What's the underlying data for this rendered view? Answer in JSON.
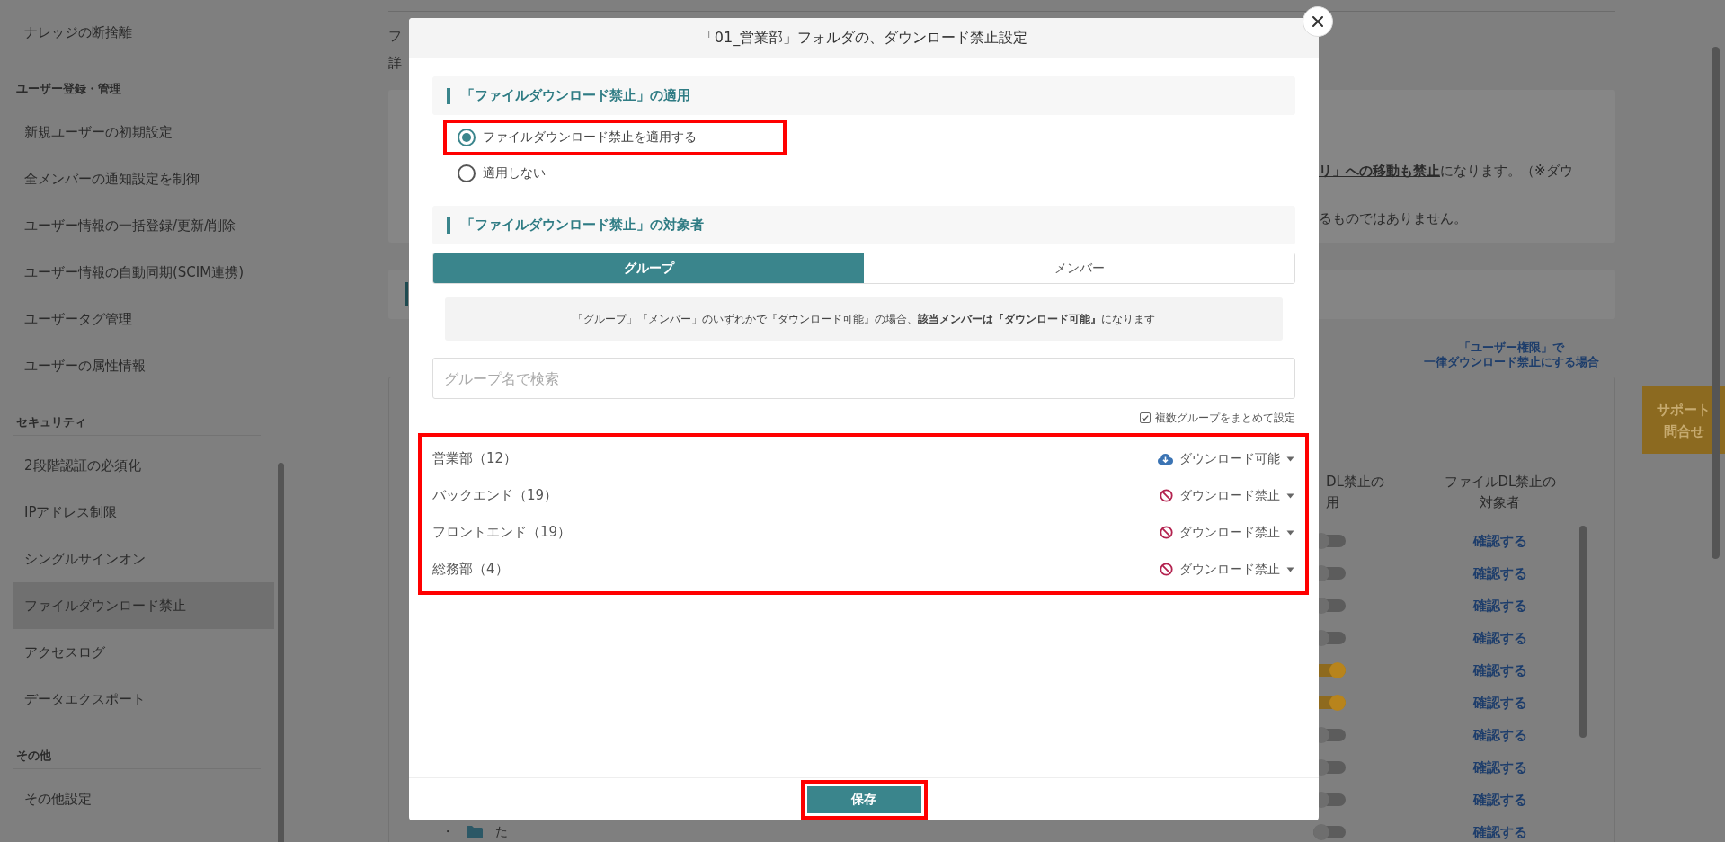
{
  "sidebar": {
    "sections": [
      {
        "items": [
          {
            "label": "ナレッジの断捨離",
            "selected": false
          }
        ]
      },
      {
        "title": "ユーザー登録・管理",
        "items": [
          {
            "label": "新規ユーザーの初期設定",
            "selected": false
          },
          {
            "label": "全メンバーの通知設定を制御",
            "selected": false
          },
          {
            "label": "ユーザー情報の一括登録/更新/削除",
            "selected": false
          },
          {
            "label": "ユーザー情報の自動同期(SCIM連携)",
            "selected": false
          },
          {
            "label": "ユーザータグ管理",
            "selected": false
          },
          {
            "label": "ユーザーの属性情報",
            "selected": false
          }
        ]
      },
      {
        "title": "セキュリティ",
        "items": [
          {
            "label": "2段階認証の必須化",
            "selected": false
          },
          {
            "label": "IPアドレス制限",
            "selected": false
          },
          {
            "label": "シングルサインオン",
            "selected": false
          },
          {
            "label": "ファイルダウンロード禁止",
            "selected": true
          },
          {
            "label": "アクセスログ",
            "selected": false
          },
          {
            "label": "データエクスポート",
            "selected": false
          }
        ]
      },
      {
        "title": "その他",
        "items": [
          {
            "label": "その他設定",
            "selected": false
          }
        ]
      }
    ]
  },
  "page": {
    "intro_lines": [
      "フ",
      "詳"
    ],
    "notice_lines": [
      "**リ」への移動も禁止**になります。（※ダウ",
      "るものではありません。"
    ],
    "user_permission_link": [
      "「ユーザー権限」で",
      "一律ダウンロード禁止にする場合"
    ],
    "table": {
      "columns": [
        {
          "lines": [
            "DL禁止の",
            "用"
          ]
        },
        {
          "lines": [
            "ファイルDL禁止の",
            "対象者"
          ]
        }
      ],
      "rows": [
        {
          "applied": false,
          "link": "確認する"
        },
        {
          "applied": false,
          "link": "確認する"
        },
        {
          "applied": false,
          "link": "確認する"
        },
        {
          "applied": false,
          "link": "確認する"
        },
        {
          "applied": true,
          "link": "確認する"
        },
        {
          "applied": true,
          "link": "確認する"
        },
        {
          "applied": false,
          "link": "確認する"
        },
        {
          "applied": false,
          "link": "確認する"
        },
        {
          "applied": false,
          "link": "確認する"
        },
        {
          "applied": false,
          "link": "確認する",
          "bullet": "・",
          "name": "た"
        }
      ]
    },
    "support_button": [
      "サポート",
      "問合せ"
    ]
  },
  "modal": {
    "title": "「01_営業部」フォルダの、ダウンロード禁止設定",
    "apply_section": {
      "heading": "「ファイルダウンロード禁止」の適用",
      "options": [
        {
          "label": "ファイルダウンロード禁止を適用する",
          "selected": true,
          "highlighted": true
        },
        {
          "label": "適用しない",
          "selected": false,
          "highlighted": false
        }
      ]
    },
    "target_section": {
      "heading": "「ファイルダウンロード禁止」の対象者",
      "tabs": [
        {
          "label": "グループ",
          "selected": true
        },
        {
          "label": "メンバー",
          "selected": false
        }
      ],
      "note": "「グループ」「メンバー」のいずれかで『ダウンロード可能』の場合、**該当メンバーは『ダウンロード可能』**になります",
      "search": {
        "placeholder": "グループ名で検索"
      },
      "bulk_option": {
        "label": "複数グループをまとめて設定",
        "checked": true
      },
      "groups_highlighted": true,
      "groups": [
        {
          "name": "営業部（12）",
          "kind": "allowed",
          "status": "ダウンロード可能"
        },
        {
          "name": "バックエンド（19）",
          "kind": "blocked",
          "status": "ダウンロード禁止"
        },
        {
          "name": "フロントエンド（19）",
          "kind": "blocked",
          "status": "ダウンロード禁止"
        },
        {
          "name": "総務部（4）",
          "kind": "blocked",
          "status": "ダウンロード禁止"
        }
      ]
    },
    "save_button": {
      "label": "保存",
      "highlighted": true
    }
  }
}
